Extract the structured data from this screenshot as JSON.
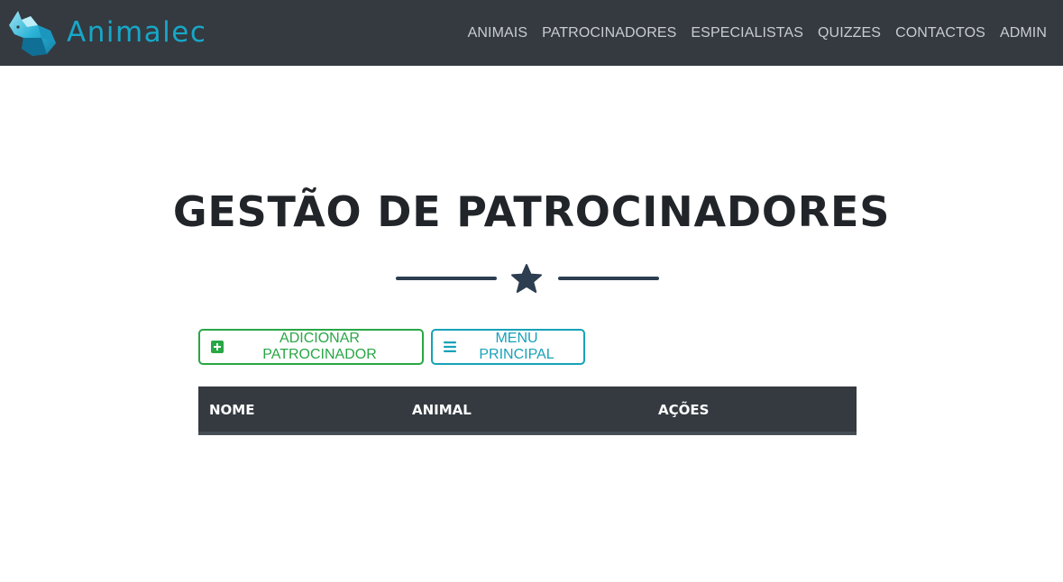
{
  "brand": {
    "name": "Animalec",
    "logo_icon": "fox-logo-icon",
    "color": "#17a7c7"
  },
  "nav": {
    "items": [
      {
        "label": "ANIMAIS"
      },
      {
        "label": "PATROCINADORES"
      },
      {
        "label": "ESPECIALISTAS"
      },
      {
        "label": "QUIZZES"
      },
      {
        "label": "CONTACTOS"
      },
      {
        "label": "ADMIN"
      }
    ],
    "background": "#343a40"
  },
  "page": {
    "title": "GESTÃO DE PATROCINADORES",
    "divider_icon": "star-icon"
  },
  "actions": {
    "add_label": "ADICIONAR PATROCINADOR",
    "add_icon": "plus-square-icon",
    "add_color": "#28a745",
    "menu_label": "MENU PRINCIPAL",
    "menu_icon": "bars-icon",
    "menu_color": "#17a2b8"
  },
  "table": {
    "columns": [
      "NOME",
      "ANIMAL",
      "AÇÕES"
    ],
    "rows": []
  }
}
